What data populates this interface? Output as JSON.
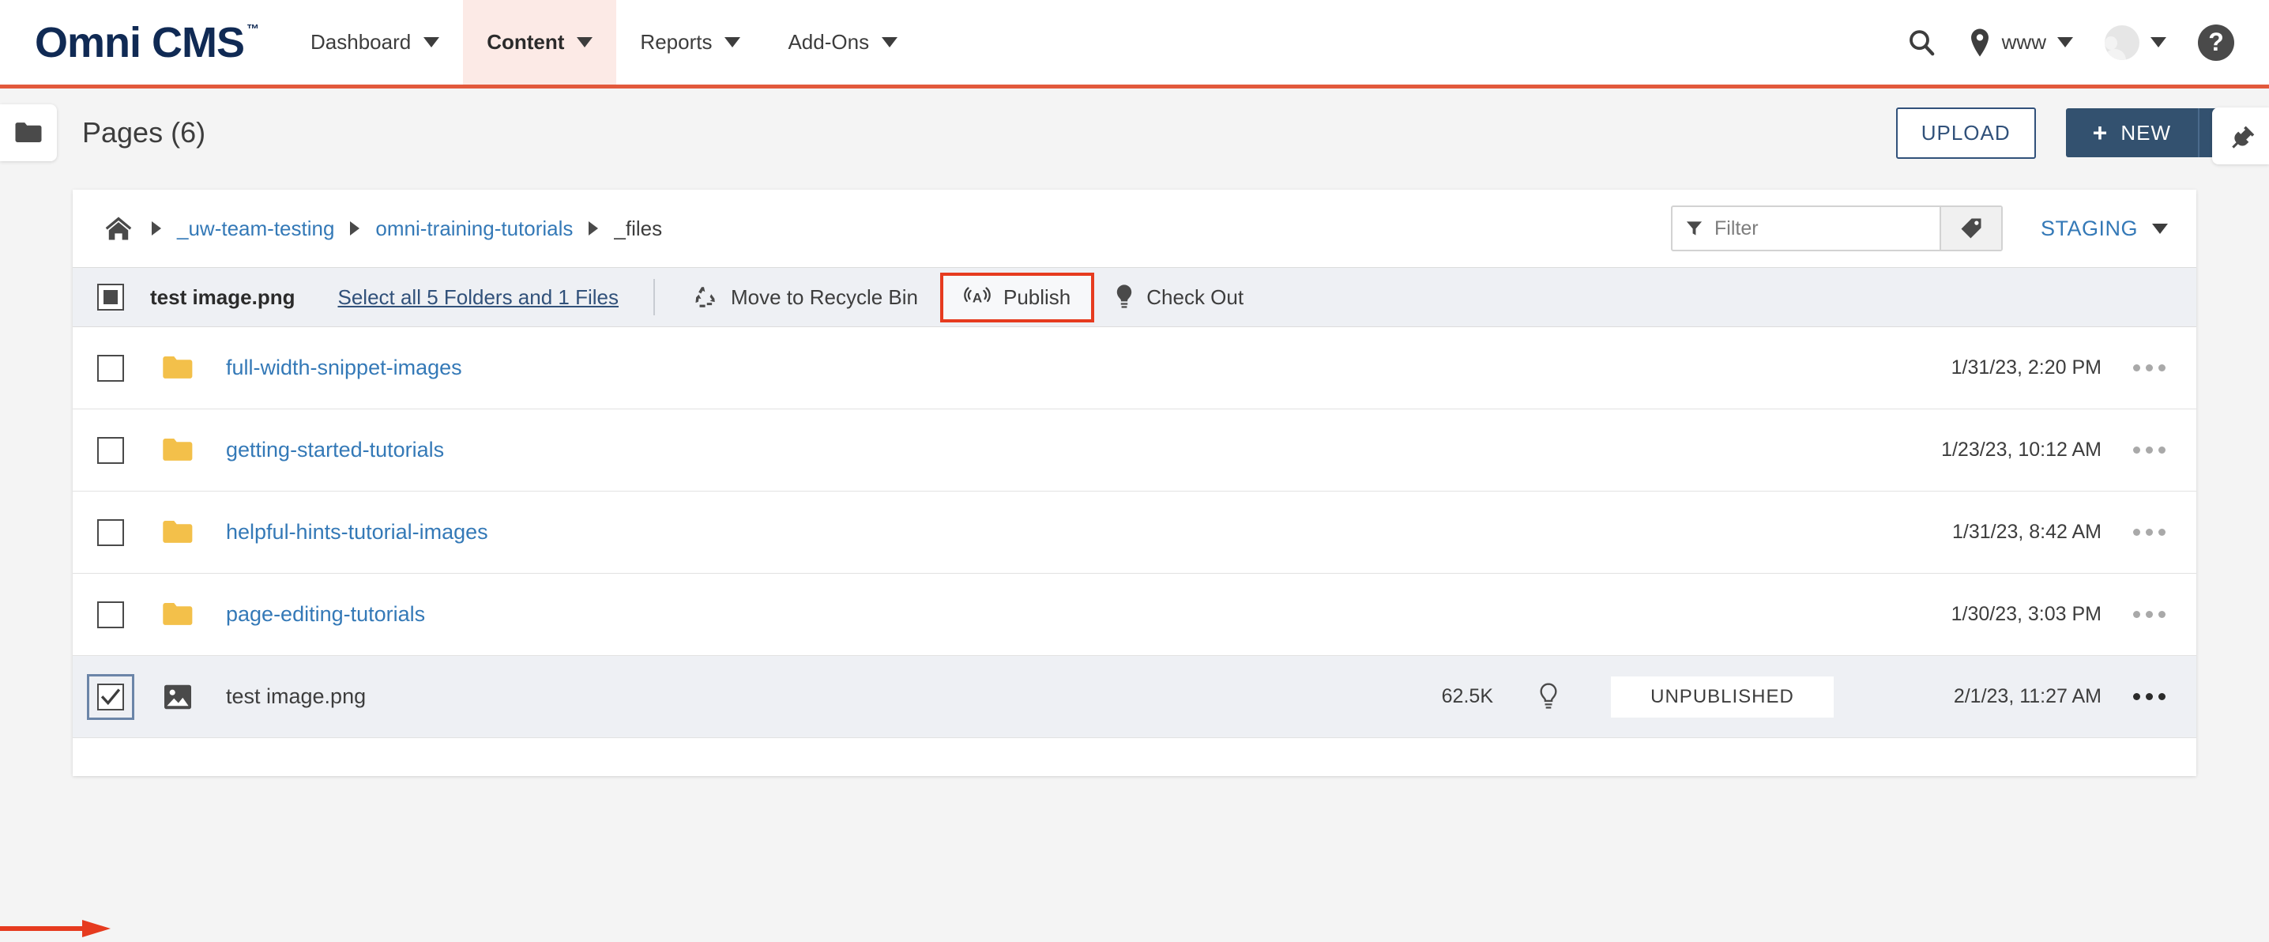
{
  "brand": {
    "name": "Omni CMS",
    "tm": "™"
  },
  "topnav": {
    "items": [
      {
        "label": "Dashboard",
        "active": false
      },
      {
        "label": "Content",
        "active": true
      },
      {
        "label": "Reports",
        "active": false
      },
      {
        "label": "Add-Ons",
        "active": false
      }
    ],
    "search_icon": "search-icon",
    "site_icon": "location-pin-icon",
    "site_label": "www",
    "avatar_icon": "user-avatar",
    "help_label": "?"
  },
  "page_header": {
    "folder_icon": "folder-icon",
    "title": "Pages (6)",
    "upload_label": "UPLOAD",
    "new_label": "NEW",
    "new_plus": "+",
    "plugin_icon": "plug-icon"
  },
  "breadcrumb": {
    "home_icon": "home-icon",
    "items": [
      {
        "label": "_uw-team-testing",
        "current": false
      },
      {
        "label": "omni-training-tutorials",
        "current": false
      },
      {
        "label": "_files",
        "current": true
      }
    ]
  },
  "filter": {
    "icon": "filter-funnel-icon",
    "placeholder": "Filter",
    "value": "",
    "tag_icon": "tag-icon"
  },
  "staging": {
    "label": "STAGING"
  },
  "actionbar": {
    "checkbox_state": "indeterminate",
    "selected_name": "test image.png",
    "select_all_label": "Select all 5 Folders and 1 Files",
    "actions": [
      {
        "label": "Move to Recycle Bin",
        "icon": "recycle-bin-icon",
        "highlighted": false
      },
      {
        "label": "Publish",
        "icon": "broadcast-publish-icon",
        "highlighted": true
      },
      {
        "label": "Check Out",
        "icon": "lightbulb-icon",
        "highlighted": false
      }
    ]
  },
  "rows": [
    {
      "type": "folder",
      "icon": "folder-yellow-icon",
      "name": "full-width-snippet-images",
      "size": "",
      "status": "",
      "date": "1/31/23, 2:20 PM",
      "checked": false,
      "selected": false,
      "menu_icon": "ellipsis-icon",
      "menu_dark": false
    },
    {
      "type": "folder",
      "icon": "folder-yellow-icon",
      "name": "getting-started-tutorials",
      "size": "",
      "status": "",
      "date": "1/23/23, 10:12 AM",
      "checked": false,
      "selected": false,
      "menu_icon": "ellipsis-icon",
      "menu_dark": false
    },
    {
      "type": "folder",
      "icon": "folder-yellow-icon",
      "name": "helpful-hints-tutorial-images",
      "size": "",
      "status": "",
      "date": "1/31/23, 8:42 AM",
      "checked": false,
      "selected": false,
      "menu_icon": "ellipsis-icon",
      "menu_dark": false
    },
    {
      "type": "folder",
      "icon": "folder-yellow-icon",
      "name": "page-editing-tutorials",
      "size": "",
      "status": "",
      "date": "1/30/23, 3:03 PM",
      "checked": false,
      "selected": false,
      "menu_icon": "ellipsis-icon",
      "menu_dark": false
    },
    {
      "type": "file",
      "icon": "image-file-icon",
      "name": "test image.png",
      "size": "62.5K",
      "status": "UNPUBLISHED",
      "date": "2/1/23, 11:27 AM",
      "checked": true,
      "selected": true,
      "menu_icon": "ellipsis-icon",
      "menu_dark": true,
      "bulb_icon": "lightbulb-outline-icon"
    }
  ],
  "colors": {
    "brand_navy": "#102a54",
    "accent_orange": "#e2593c",
    "active_tab_bg": "#fceae6",
    "link_blue": "#3479b7",
    "button_navy": "#33516f",
    "highlight_red": "#e63b1f",
    "selected_row": "#eef0f4",
    "folder_yellow": "#f3c04a"
  },
  "annotation": {
    "arrow_icon": "red-pointer-arrow",
    "color": "#e63b1f"
  }
}
